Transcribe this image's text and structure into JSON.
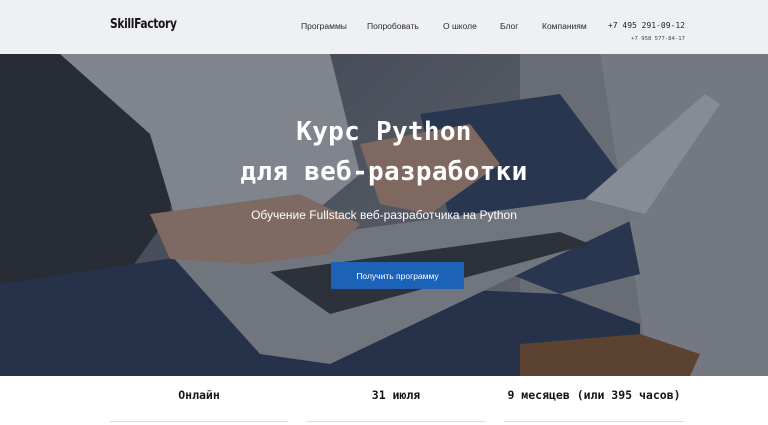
{
  "header": {
    "logo": "SkillFactory",
    "nav": [
      "Программы",
      "Попробовать",
      "О школе",
      "Блог",
      "Компаниям"
    ],
    "phone_main": "+7 495 291-09-12",
    "phone_alt": "+7 958 577-84-17"
  },
  "hero": {
    "title_line1": "Курс Python",
    "title_line2": "для веб-разработки",
    "subtitle": "Обучение Fullstack веб-разработчика на Python",
    "cta_label": "Получить программу"
  },
  "info": [
    "Онлайн",
    "31 июля",
    "9 месяцев (или 395 часов)"
  ],
  "colors": {
    "header_bg": "#eef0f3",
    "cta_bg": "#1c62b8",
    "hero_overlay": "rgba(28,34,45,0.42)"
  }
}
